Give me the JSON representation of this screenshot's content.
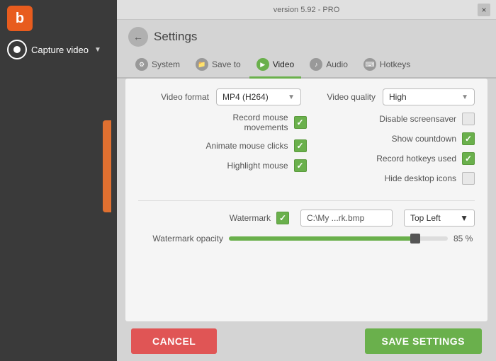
{
  "app": {
    "version": "version 5.92 - PRO",
    "close_label": "×"
  },
  "sidebar": {
    "capture_label": "Capture video",
    "chevron": "▼"
  },
  "settings": {
    "title": "Settings",
    "back_icon": "←"
  },
  "tabs": [
    {
      "id": "system",
      "label": "System",
      "active": false
    },
    {
      "id": "saveto",
      "label": "Save to",
      "active": false
    },
    {
      "id": "video",
      "label": "Video",
      "active": true
    },
    {
      "id": "audio",
      "label": "Audio",
      "active": false
    },
    {
      "id": "hotkeys",
      "label": "Hotkeys",
      "active": false
    }
  ],
  "video": {
    "format_label": "Video format",
    "format_value": "MP4 (H264)",
    "quality_label": "Video quality",
    "quality_value": "High",
    "checkboxes": {
      "record_mouse_label": "Record mouse\nmovements",
      "record_mouse_checked": true,
      "animate_clicks_label": "Animate mouse clicks",
      "animate_clicks_checked": true,
      "highlight_mouse_label": "Highlight mouse",
      "highlight_mouse_checked": true,
      "disable_screensaver_label": "Disable screensaver",
      "disable_screensaver_checked": false,
      "show_countdown_label": "Show countdown",
      "show_countdown_checked": true,
      "record_hotkeys_label": "Record hotkeys used",
      "record_hotkeys_checked": true,
      "hide_desktop_label": "Hide desktop icons",
      "hide_desktop_checked": false
    },
    "watermark_label": "Watermark",
    "watermark_checked": true,
    "watermark_path": "C:\\My ...rk.bmp",
    "watermark_position_label": "Top Left",
    "watermark_opacity_label": "Watermark opacity",
    "watermark_opacity_value": "85 %"
  },
  "buttons": {
    "cancel_label": "CANCEL",
    "save_label": "SAVE SETTINGS"
  }
}
